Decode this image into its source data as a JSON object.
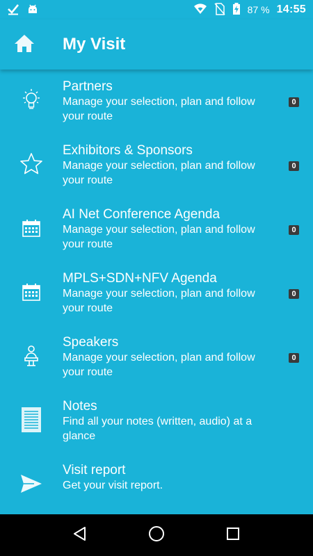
{
  "status_bar": {
    "battery_percent": "87 %",
    "time": "14:55",
    "icons": [
      "check-icon",
      "android-icon",
      "wifi-icon",
      "no-sim-icon",
      "battery-charging-icon"
    ]
  },
  "app_bar": {
    "title": "My Visit",
    "icon": "home-icon"
  },
  "list": {
    "items": [
      {
        "icon": "lightbulb-icon",
        "title": "Partners",
        "subtitle": "Manage your selection, plan and follow your route",
        "badge": "0"
      },
      {
        "icon": "star-icon",
        "title": "Exhibitors & Sponsors",
        "subtitle": "Manage your selection, plan and follow your route",
        "badge": "0"
      },
      {
        "icon": "calendar-icon",
        "title": "AI Net Conference Agenda",
        "subtitle": "Manage your selection, plan and follow your route",
        "badge": "0"
      },
      {
        "icon": "calendar-icon",
        "title": "MPLS+SDN+NFV Agenda",
        "subtitle": "Manage your selection, plan and follow your route",
        "badge": "0"
      },
      {
        "icon": "speaker-icon",
        "title": "Speakers",
        "subtitle": "Manage your selection, plan and follow your route",
        "badge": "0"
      },
      {
        "icon": "notes-icon",
        "title": "Notes",
        "subtitle": "Find all your notes (written, audio) at a glance"
      },
      {
        "icon": "send-icon",
        "title": "Visit report",
        "subtitle": "Get your visit report."
      }
    ]
  },
  "colors": {
    "background": "#1ab3d8",
    "badge": "#3a3a3a",
    "nav_bar": "#000000",
    "text": "#ffffff"
  },
  "nav_bar": {
    "icons": [
      "back-icon",
      "home-circle-icon",
      "recents-icon"
    ]
  }
}
